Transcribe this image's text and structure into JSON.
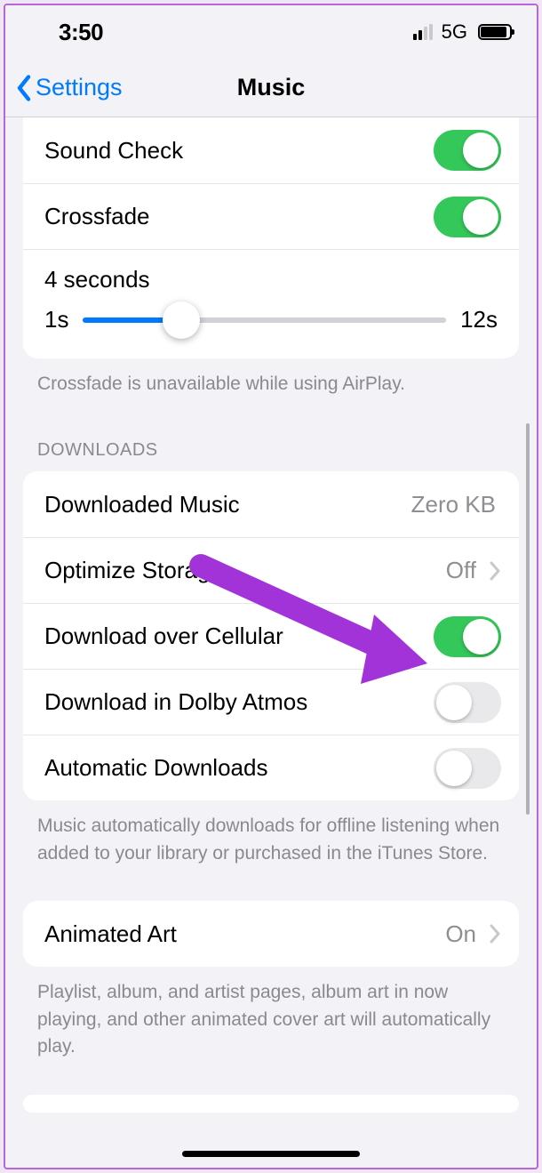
{
  "status": {
    "time": "3:50",
    "network": "5G"
  },
  "nav": {
    "back_label": "Settings",
    "title": "Music"
  },
  "playback": {
    "sound_check_label": "Sound Check",
    "sound_check_on": true,
    "crossfade_label": "Crossfade",
    "crossfade_on": true,
    "crossfade_value": "4 seconds",
    "crossfade_min": "1s",
    "crossfade_max": "12s",
    "footer": "Crossfade is unavailable while using AirPlay."
  },
  "downloads": {
    "header": "DOWNLOADS",
    "downloaded_music_label": "Downloaded Music",
    "downloaded_music_value": "Zero KB",
    "optimize_label": "Optimize Storage",
    "optimize_value": "Off",
    "cellular_label": "Download over Cellular",
    "cellular_on": true,
    "dolby_label": "Download in Dolby Atmos",
    "dolby_on": false,
    "auto_label": "Automatic Downloads",
    "auto_on": false,
    "footer": "Music automatically downloads for offline listening when added to your library or purchased in the iTunes Store."
  },
  "animated": {
    "label": "Animated Art",
    "value": "On",
    "footer": "Playlist, album, and artist pages, album art in now playing, and other animated cover art will automatically play."
  },
  "annotation": {
    "arrow_color": "#a233d9"
  }
}
